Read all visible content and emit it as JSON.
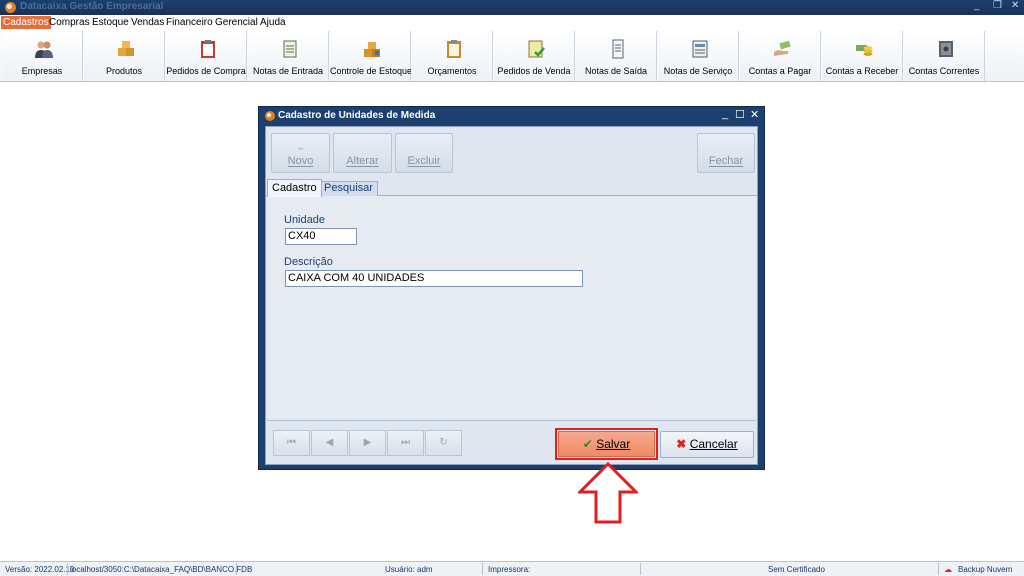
{
  "window": {
    "title": "Datacaixa Gestão Empresarial"
  },
  "menu": [
    "Cadastros",
    "Compras",
    "Estoque",
    "Vendas",
    "Financeiro",
    "Gerencial",
    "Ajuda"
  ],
  "toolbar": [
    {
      "label": "Empresas",
      "icon": "users-icon"
    },
    {
      "label": "Produtos",
      "icon": "boxes-icon"
    },
    {
      "label": "Pedidos de Compra",
      "icon": "clipboard-icon"
    },
    {
      "label": "Notas de Entrada",
      "icon": "notepad-icon"
    },
    {
      "label": "Controle de Estoque",
      "icon": "stock-boxes-icon"
    },
    {
      "label": "Orçamentos",
      "icon": "clipboard-list-icon"
    },
    {
      "label": "Pedidos de Venda",
      "icon": "order-check-icon"
    },
    {
      "label": "Notas de Saída",
      "icon": "note-out-icon"
    },
    {
      "label": "Notas de Serviço",
      "icon": "service-note-icon"
    },
    {
      "label": "Contas a Pagar",
      "icon": "hand-money-icon"
    },
    {
      "label": "Contas a Receber",
      "icon": "coins-icon"
    },
    {
      "label": "Contas Correntes",
      "icon": "safe-icon"
    }
  ],
  "dialog": {
    "title": "Cadastro de Unidades de Medida",
    "buttons": {
      "novo": "Novo",
      "alterar": "Alterar",
      "excluir": "Excluir",
      "fechar": "Fechar"
    },
    "tabs": [
      "Cadastro",
      "Pesquisar"
    ],
    "fields": {
      "unidade": {
        "label": "Unidade",
        "value": "CX40"
      },
      "descricao": {
        "label": "Descrição",
        "value": "CAIXA COM 40 UNIDADES"
      }
    },
    "nav_glyphs": [
      "⏮",
      "◀",
      "▶",
      "⏭",
      "↻"
    ],
    "save_label": "Salvar",
    "cancel_label": "Cancelar"
  },
  "status": {
    "version": "Versão: 2022.02.10",
    "database": "localhost/3050:C:\\Datacaixa_FAQ\\BD\\BANCO.FDB",
    "user": "Usuário: adm",
    "printer": "Impressora:",
    "certificate": "Sem Certificado",
    "backup": "Backup Nuvem"
  },
  "colors": {
    "accent": "#e56e3a",
    "highlight": "#e21e1e",
    "titlebar": "#1d3f6e"
  }
}
